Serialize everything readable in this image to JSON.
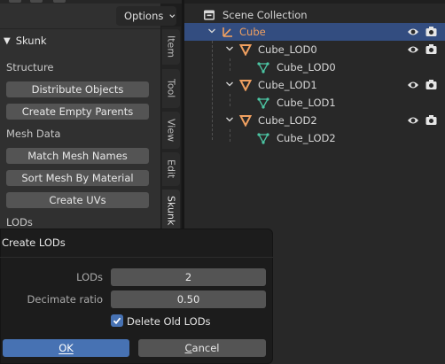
{
  "sidebar": {
    "options_label": "Options",
    "panel_title": "Skunk",
    "sections": [
      {
        "label": "Structure",
        "buttons": [
          "Distribute Objects",
          "Create Empty Parents"
        ]
      },
      {
        "label": "Mesh Data",
        "buttons": [
          "Match Mesh Names",
          "Sort Mesh By Material",
          "Create UVs"
        ]
      },
      {
        "label": "LODs"
      }
    ],
    "tabs": [
      "Item",
      "Tool",
      "View",
      "Edit",
      "Skunk"
    ]
  },
  "outliner": {
    "root": "Scene Collection",
    "rows": [
      {
        "label": "Cube",
        "kind": "empty"
      },
      {
        "label": "Cube_LOD0",
        "kind": "object"
      },
      {
        "label": "Cube_LOD0",
        "kind": "mesh"
      },
      {
        "label": "Cube_LOD1",
        "kind": "object"
      },
      {
        "label": "Cube_LOD1",
        "kind": "mesh"
      },
      {
        "label": "Cube_LOD2",
        "kind": "object"
      },
      {
        "label": "Cube_LOD2",
        "kind": "mesh"
      }
    ]
  },
  "dialog": {
    "title": "Create LODs",
    "lods_label": "LODs",
    "lods_value": "2",
    "decimate_label": "Decimate ratio",
    "decimate_value": "0.50",
    "delete_old_label": "Delete Old LODs",
    "delete_old_checked": true,
    "ok_label": "OK",
    "cancel_first": "C",
    "cancel_rest": "ancel"
  },
  "colors": {
    "accent": "#4772b3",
    "selection": "#334d80",
    "object_orange": "#f0a060",
    "mesh_green": "#4cc6a4"
  }
}
